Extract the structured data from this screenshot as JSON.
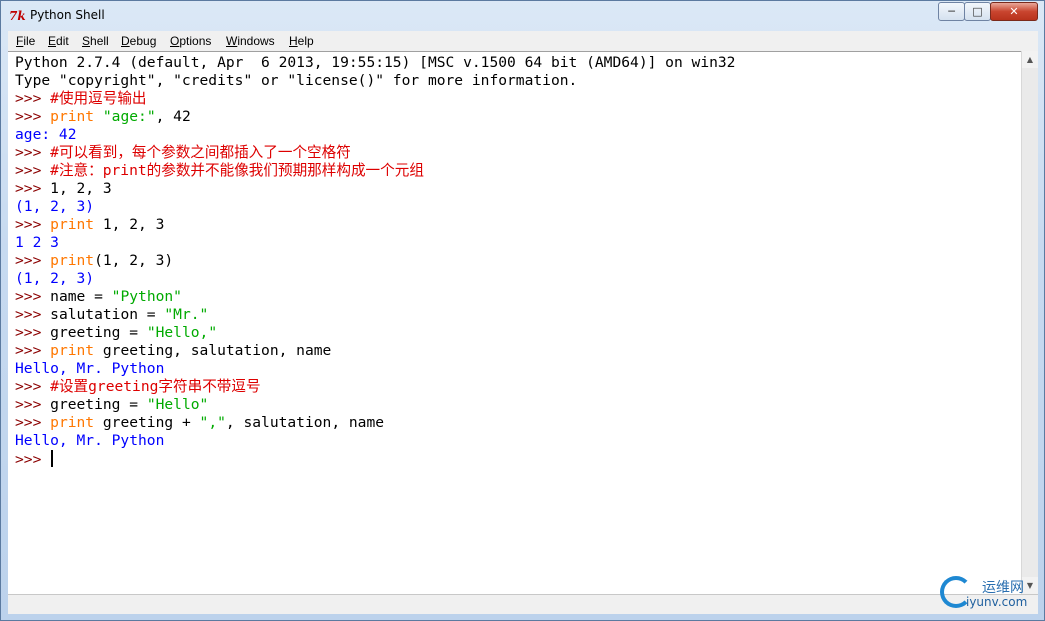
{
  "window": {
    "title": "Python Shell",
    "icon_glyph": "7k",
    "controls": {
      "minimize": "─",
      "maximize": "□",
      "close": "✕"
    }
  },
  "menu": [
    "File",
    "Edit",
    "Shell",
    "Debug",
    "Options",
    "Windows",
    "Help"
  ],
  "shell": {
    "lines": [
      [
        {
          "t": "plain",
          "s": "Python 2.7.4 (default, Apr  6 2013, 19:55:15) [MSC v.1500 64 bit (AMD64)] on win32"
        }
      ],
      [
        {
          "t": "plain",
          "s": "Type \"copyright\", \"credits\" or \"license()\" for more information."
        }
      ],
      [
        {
          "t": "prompt",
          "s": ">>> "
        },
        {
          "t": "cm",
          "s": "#使用逗号输出"
        }
      ],
      [
        {
          "t": "prompt",
          "s": ">>> "
        },
        {
          "t": "kw",
          "s": "print"
        },
        {
          "t": "plain",
          "s": " "
        },
        {
          "t": "str",
          "s": "\"age:\""
        },
        {
          "t": "plain",
          "s": ", 42"
        }
      ],
      [
        {
          "t": "out",
          "s": "age: 42"
        }
      ],
      [
        {
          "t": "prompt",
          "s": ">>> "
        },
        {
          "t": "cm",
          "s": "#可以看到，每个参数之间都插入了一个空格符"
        }
      ],
      [
        {
          "t": "prompt",
          "s": ">>> "
        },
        {
          "t": "cm",
          "s": "#注意：print的参数并不能像我们预期那样构成一个元组"
        }
      ],
      [
        {
          "t": "prompt",
          "s": ">>> "
        },
        {
          "t": "plain",
          "s": "1, 2, 3"
        }
      ],
      [
        {
          "t": "out",
          "s": "(1, 2, 3)"
        }
      ],
      [
        {
          "t": "prompt",
          "s": ">>> "
        },
        {
          "t": "kw",
          "s": "print"
        },
        {
          "t": "plain",
          "s": " 1, 2, 3"
        }
      ],
      [
        {
          "t": "out",
          "s": "1 2 3"
        }
      ],
      [
        {
          "t": "prompt",
          "s": ">>> "
        },
        {
          "t": "kw",
          "s": "print"
        },
        {
          "t": "plain",
          "s": "(1, 2, 3)"
        }
      ],
      [
        {
          "t": "out",
          "s": "(1, 2, 3)"
        }
      ],
      [
        {
          "t": "prompt",
          "s": ">>> "
        },
        {
          "t": "plain",
          "s": "name = "
        },
        {
          "t": "str",
          "s": "\"Python\""
        }
      ],
      [
        {
          "t": "prompt",
          "s": ">>> "
        },
        {
          "t": "plain",
          "s": "salutation = "
        },
        {
          "t": "str",
          "s": "\"Mr.\""
        }
      ],
      [
        {
          "t": "prompt",
          "s": ">>> "
        },
        {
          "t": "plain",
          "s": "greeting = "
        },
        {
          "t": "str",
          "s": "\"Hello,\""
        }
      ],
      [
        {
          "t": "prompt",
          "s": ">>> "
        },
        {
          "t": "kw",
          "s": "print"
        },
        {
          "t": "plain",
          "s": " greeting, salutation, name"
        }
      ],
      [
        {
          "t": "out",
          "s": "Hello, Mr. Python"
        }
      ],
      [
        {
          "t": "prompt",
          "s": ">>> "
        },
        {
          "t": "cm",
          "s": "#设置greeting字符串不带逗号"
        }
      ],
      [
        {
          "t": "prompt",
          "s": ">>> "
        },
        {
          "t": "plain",
          "s": "greeting = "
        },
        {
          "t": "str",
          "s": "\"Hello\""
        }
      ],
      [
        {
          "t": "prompt",
          "s": ">>> "
        },
        {
          "t": "kw",
          "s": "print"
        },
        {
          "t": "plain",
          "s": " greeting + "
        },
        {
          "t": "str",
          "s": "\",\""
        },
        {
          "t": "plain",
          "s": ", salutation, name"
        }
      ],
      [
        {
          "t": "out",
          "s": "Hello, Mr. Python"
        }
      ],
      [
        {
          "t": "prompt",
          "s": ">>> "
        },
        {
          "t": "cursor",
          "s": ""
        }
      ]
    ]
  },
  "colors": {
    "prompt": "#8b0000",
    "keyword": "#ff7700",
    "string": "#00aa00",
    "comment": "#dd0000",
    "output": "#0000ff"
  },
  "watermark": {
    "name": "运维网",
    "sub": "iyunv.com"
  }
}
